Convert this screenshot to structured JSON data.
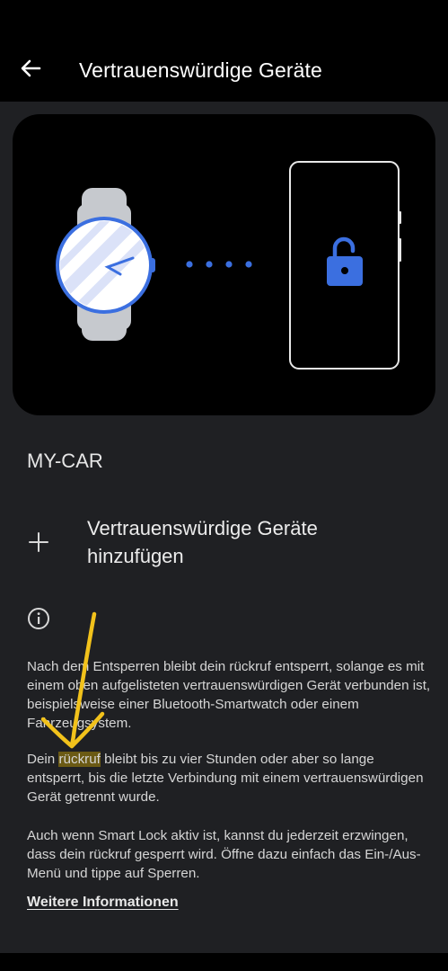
{
  "header": {
    "title": "Vertrauenswürdige Geräte"
  },
  "device": {
    "name": "MY-CAR"
  },
  "add_action": {
    "label": "Vertrauenswürdige Geräte hinzufügen"
  },
  "info": {
    "paragraph1_a": "Nach dem Entsperren bleibt dein ",
    "paragraph1_word": "rückruf",
    "paragraph1_b": " entsperrt, solange es mit einem oben aufgelisteten vertrauenswürdigen Gerät verbunden ist, beispielsweise einer Bluetooth-Smartwatch oder einem Fahrzeugsystem.",
    "paragraph2_a": "Dein ",
    "paragraph2_word": "rückruf",
    "paragraph2_b": " bleibt bis zu vier Stunden oder aber so lange entsperrt, bis die letzte Verbindung mit einem vertrauenswürdigen Gerät getrennt wurde.",
    "paragraph3": "Auch wenn Smart Lock aktiv ist, kannst du jederzeit erzwingen, dass dein rückruf gesperrt wird. Öffne dazu einfach das Ein-/Aus-Menü und tippe auf Sperren.",
    "more_link": "Weitere Informationen"
  },
  "icons": {
    "back": "arrow-back-icon",
    "watch": "smartwatch-illustration",
    "phone": "phone-illustration",
    "lock": "unlocked-padlock-icon",
    "plus": "plus-icon",
    "info": "info-icon"
  },
  "colors": {
    "background": "#1f2023",
    "bar": "#000000",
    "accent_blue": "#3b6fe0",
    "highlight": "#6b5a14",
    "annotation": "#f2c21b"
  }
}
